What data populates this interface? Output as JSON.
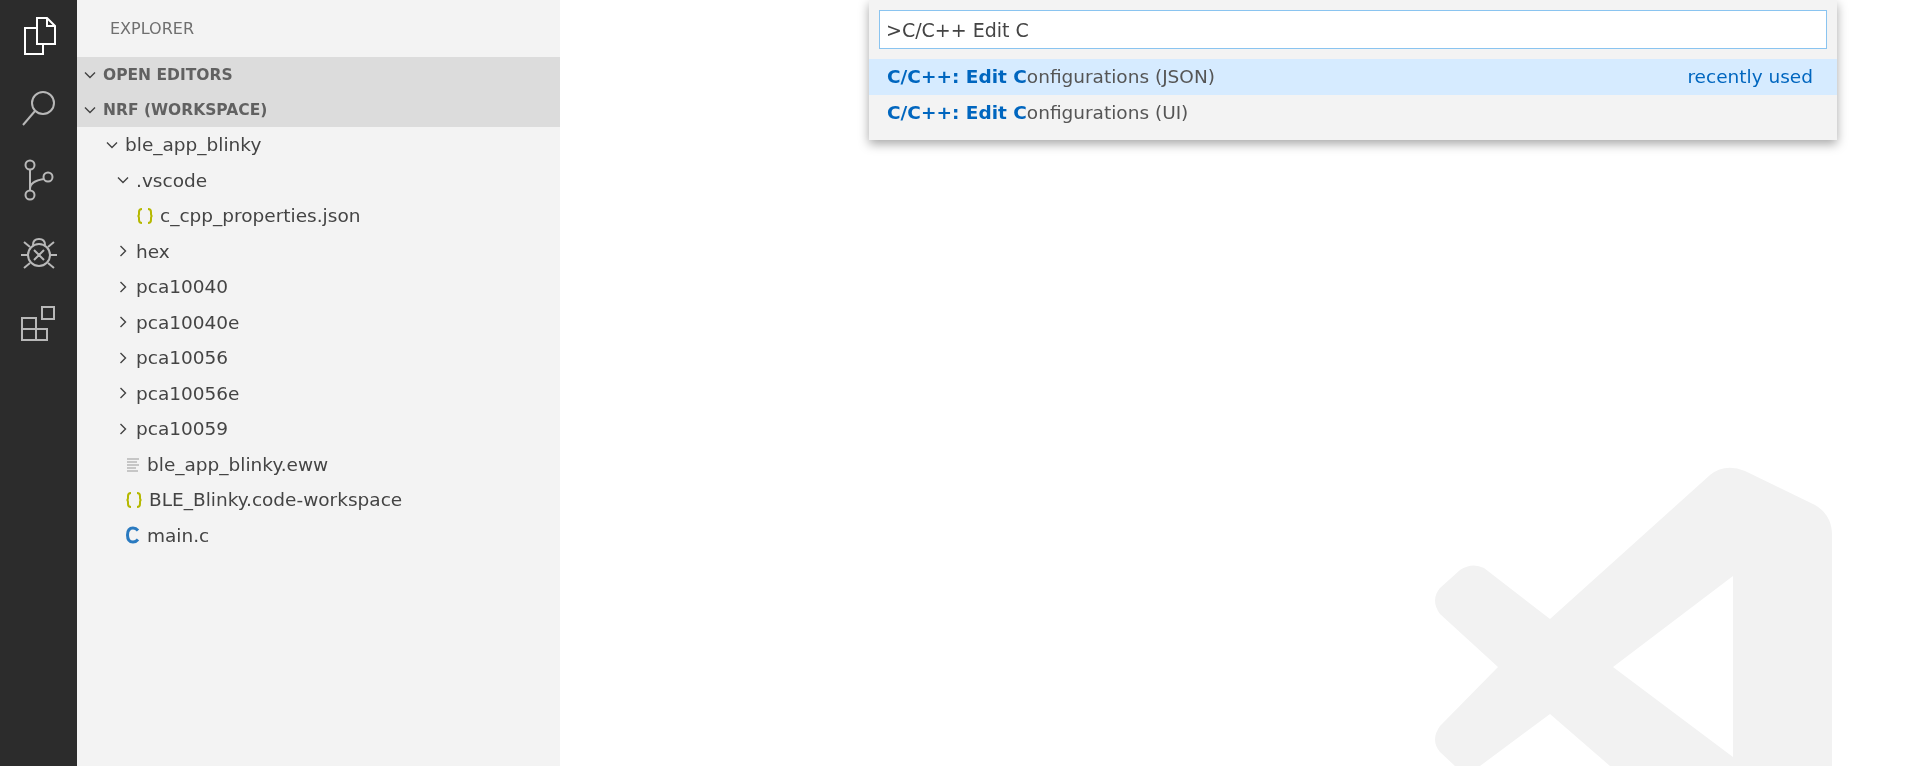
{
  "activity_bar": {
    "items": [
      {
        "kind": "files",
        "selected": true
      },
      {
        "kind": "search",
        "selected": false
      },
      {
        "kind": "source-control",
        "selected": false
      },
      {
        "kind": "debug",
        "selected": false
      },
      {
        "kind": "extensions",
        "selected": false
      }
    ]
  },
  "sidebar": {
    "title": "EXPLORER",
    "sections": [
      {
        "label": "OPEN EDITORS",
        "expanded": true
      },
      {
        "label": "NRF (WORKSPACE)",
        "expanded": true
      }
    ],
    "tree": [
      {
        "label": "ble_app_blinky",
        "kind": "folder",
        "expanded": true,
        "children": [
          {
            "label": ".vscode",
            "kind": "folder",
            "expanded": true,
            "children": [
              {
                "label": "c_cpp_properties.json",
                "kind": "json"
              }
            ]
          },
          {
            "label": "hex",
            "kind": "folder",
            "expanded": false
          },
          {
            "label": "pca10040",
            "kind": "folder",
            "expanded": false
          },
          {
            "label": "pca10040e",
            "kind": "folder",
            "expanded": false
          },
          {
            "label": "pca10056",
            "kind": "folder",
            "expanded": false
          },
          {
            "label": "pca10056e",
            "kind": "folder",
            "expanded": false
          },
          {
            "label": "pca10059",
            "kind": "folder",
            "expanded": false
          },
          {
            "label": "ble_app_blinky.eww",
            "kind": "text"
          },
          {
            "label": "BLE_Blinky.code-workspace",
            "kind": "json"
          },
          {
            "label": "main.c",
            "kind": "c"
          }
        ]
      }
    ]
  },
  "command_palette": {
    "value": ">C/C++ Edit C",
    "results": [
      {
        "text": "**C/C++: Edit C**onfigurations (JSON)",
        "hint": "recently used",
        "selected": true
      },
      {
        "text": "**C/C++: Edit C**onfigurations (UI)",
        "selected": false
      }
    ]
  }
}
